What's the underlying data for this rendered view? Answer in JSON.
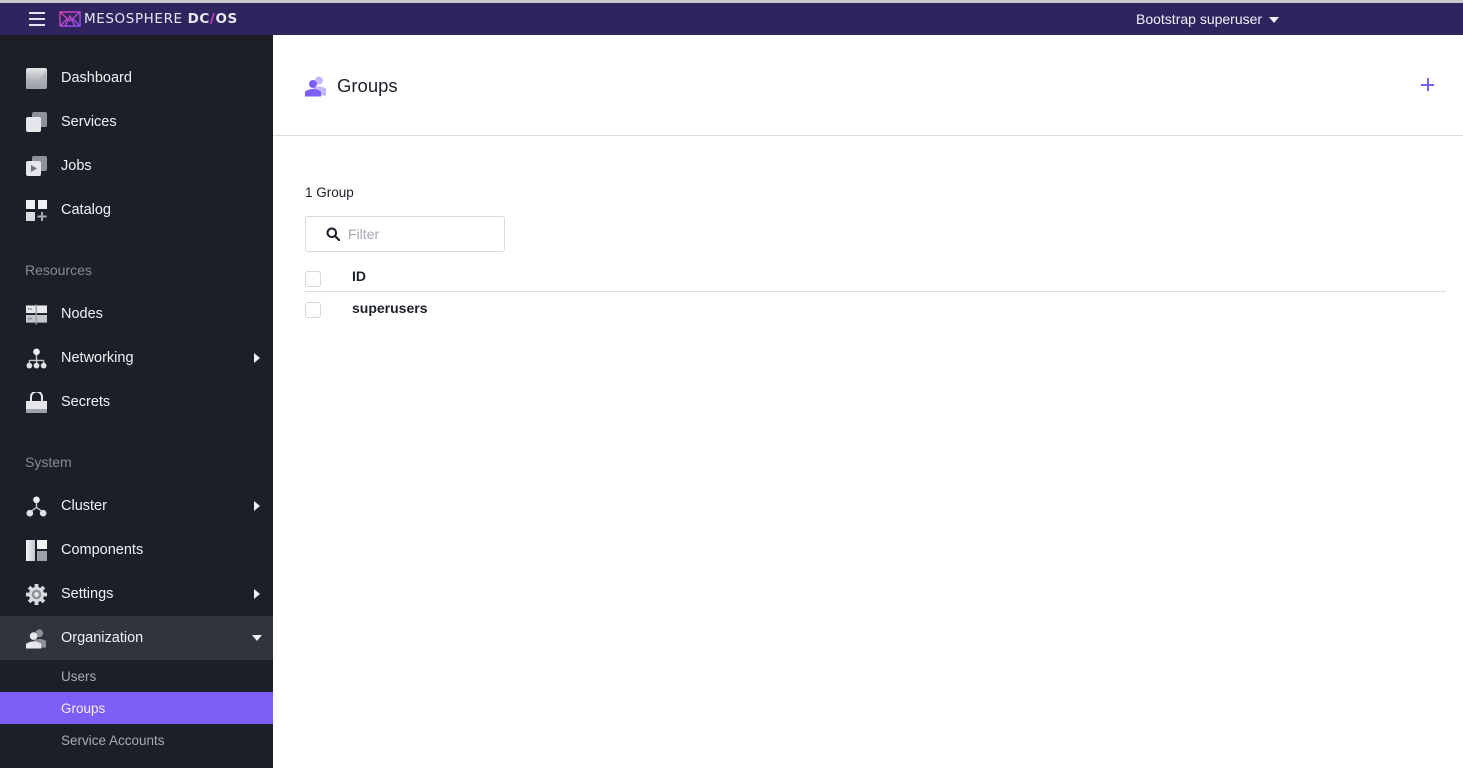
{
  "header": {
    "menu_icon": "hamburger-icon",
    "logo": {
      "brand": "MESOSPHERE",
      "product_a": "DC",
      "separator": "/",
      "product_b": "OS"
    },
    "user_menu_label": "Bootstrap superuser",
    "user_menu_icon": "caret-down-icon"
  },
  "sidebar": {
    "primary": [
      {
        "label": "Dashboard",
        "icon": "dashboard-icon"
      },
      {
        "label": "Services",
        "icon": "services-icon"
      },
      {
        "label": "Jobs",
        "icon": "jobs-icon"
      },
      {
        "label": "Catalog",
        "icon": "catalog-icon"
      }
    ],
    "sections": [
      {
        "title": "Resources",
        "items": [
          {
            "label": "Nodes",
            "icon": "nodes-icon"
          },
          {
            "label": "Networking",
            "icon": "networking-icon",
            "has_submenu": true
          },
          {
            "label": "Secrets",
            "icon": "lock-icon"
          }
        ]
      },
      {
        "title": "System",
        "items": [
          {
            "label": "Cluster",
            "icon": "cluster-icon",
            "has_submenu": true
          },
          {
            "label": "Components",
            "icon": "components-icon"
          },
          {
            "label": "Settings",
            "icon": "gear-icon",
            "has_submenu": true
          },
          {
            "label": "Organization",
            "icon": "users-icon",
            "expanded": true
          }
        ]
      }
    ],
    "organization_submenu": [
      {
        "label": "Users",
        "active": false
      },
      {
        "label": "Groups",
        "active": true
      },
      {
        "label": "Service Accounts",
        "active": false
      }
    ]
  },
  "page": {
    "title": "Groups",
    "title_icon": "groups-icon",
    "add_button_icon": "plus-icon",
    "count_label": "1 Group",
    "filter": {
      "placeholder": "Filter",
      "value": ""
    },
    "table": {
      "columns": [
        "ID"
      ],
      "rows": [
        {
          "id": "superusers"
        }
      ]
    }
  },
  "colors": {
    "header_bg": "#2f245e",
    "sidebar_bg": "#1c1f27",
    "accent": "#7b5ff7",
    "expanded_item_bg": "#31343d"
  }
}
